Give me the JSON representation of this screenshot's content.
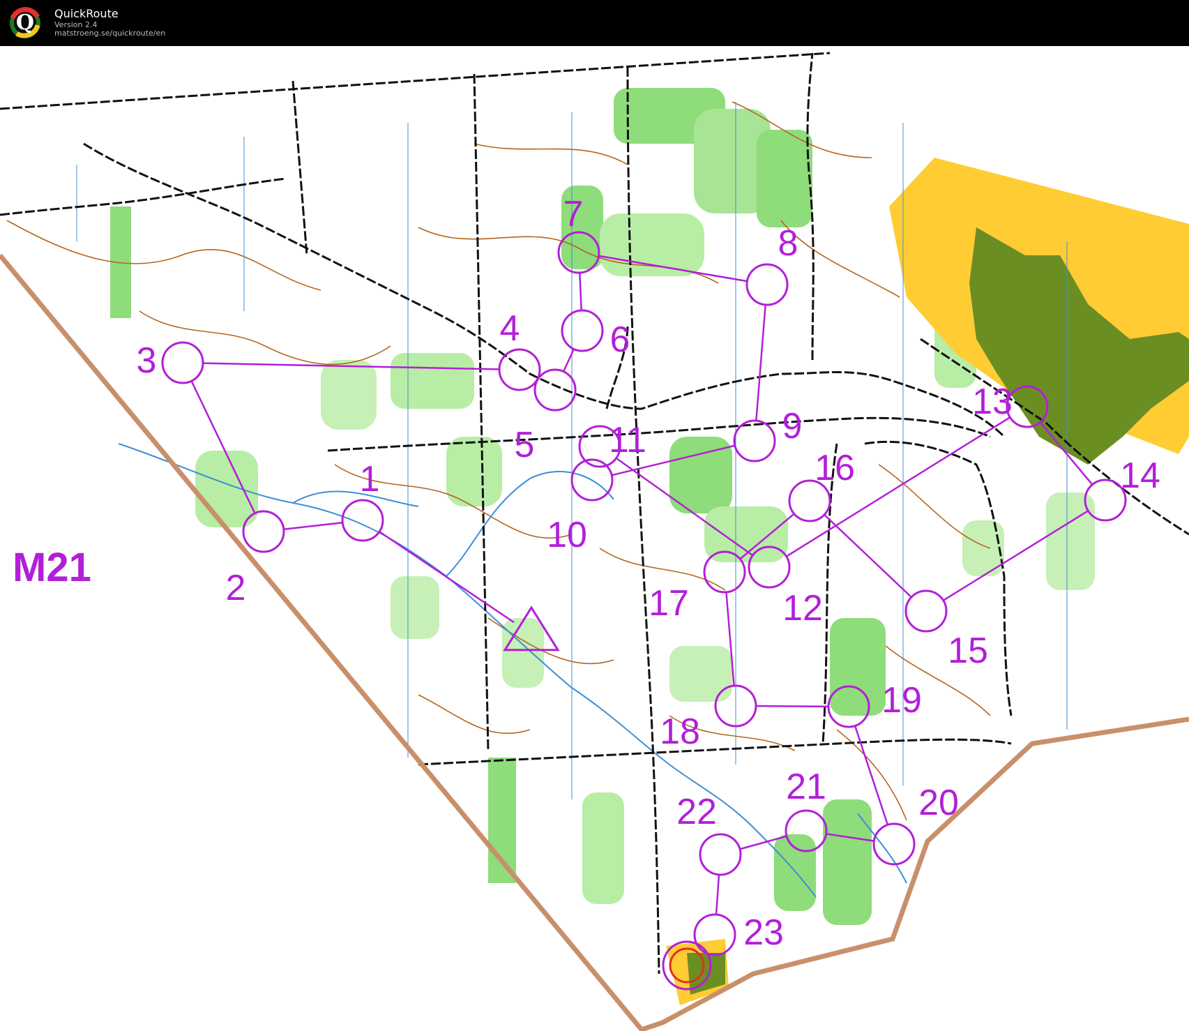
{
  "app": {
    "title": "QuickRoute",
    "version": "Version 2.4",
    "url": "matstroeng.se/quickroute/en",
    "logo_letter": "Q"
  },
  "map": {
    "class_label": "M21",
    "colors": {
      "course": "#b21fd8",
      "forest_green": "#8fdc7a",
      "light_green": "#c6f0b6",
      "open_land": "#ffcc33",
      "olive": "#6b8e23",
      "contour": "#b5651d",
      "water": "#3d8fd6",
      "boundary": "#c8906a",
      "track": "#000000"
    },
    "controls": [
      {
        "label": "1"
      },
      {
        "label": "2"
      },
      {
        "label": "3"
      },
      {
        "label": "4"
      },
      {
        "label": "5"
      },
      {
        "label": "6"
      },
      {
        "label": "7"
      },
      {
        "label": "8"
      },
      {
        "label": "9"
      },
      {
        "label": "10"
      },
      {
        "label": "11"
      },
      {
        "label": "12"
      },
      {
        "label": "13"
      },
      {
        "label": "14"
      },
      {
        "label": "15"
      },
      {
        "label": "16"
      },
      {
        "label": "17"
      },
      {
        "label": "18"
      },
      {
        "label": "19"
      },
      {
        "label": "20"
      },
      {
        "label": "21"
      },
      {
        "label": "22"
      },
      {
        "label": "23"
      }
    ]
  }
}
